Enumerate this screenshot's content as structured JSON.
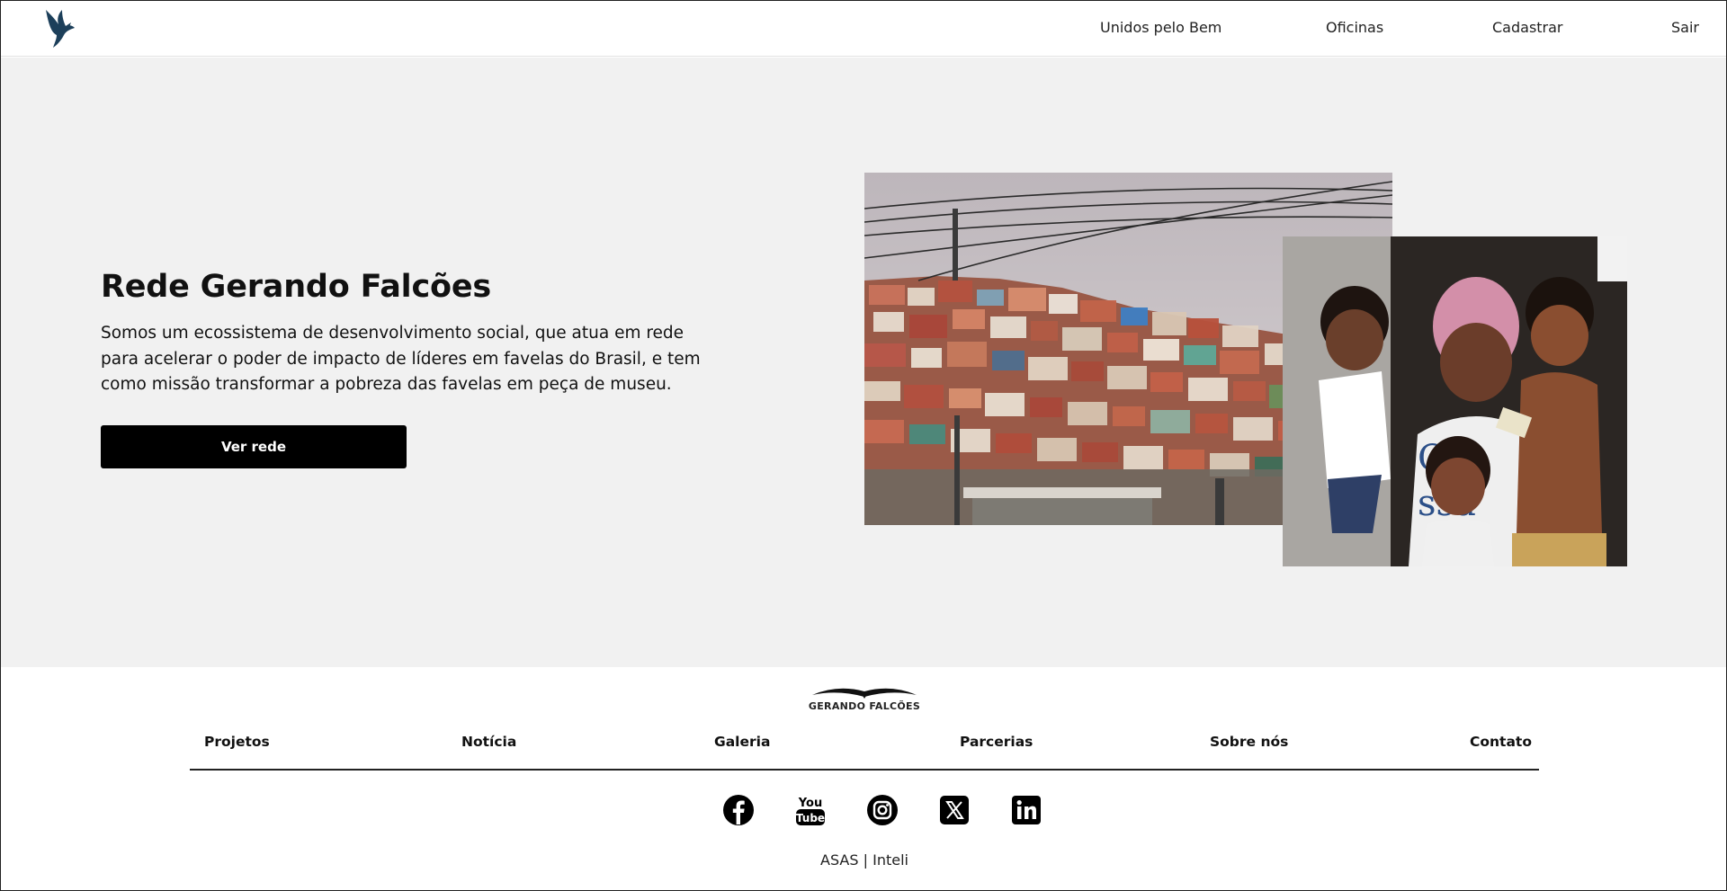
{
  "nav": {
    "logo_icon": "falcon-bird-icon",
    "links": [
      "Unidos pelo Bem",
      "Oficinas",
      "Cadastrar",
      "Sair"
    ]
  },
  "hero": {
    "title": "Rede Gerando Falcões",
    "description": "Somos um ecossistema de desenvolvimento social, que atua em rede para acelerar o poder de impacto de líderes em favelas do Brasil, e tem como missão transformar a pobreza das favelas em peça de museu.",
    "button_label": "Ver rede",
    "images": [
      "favela-hillside-photo",
      "family-children-photo"
    ]
  },
  "footer": {
    "brand": "GERANDO FALCÕES",
    "links": [
      "Projetos",
      "Notícia",
      "Galeria",
      "Parcerias",
      "Sobre nós",
      "Contato"
    ],
    "social_icons": [
      "facebook-icon",
      "youtube-icon",
      "instagram-icon",
      "x-twitter-icon",
      "linkedin-icon"
    ],
    "copyright": "ASAS | Inteli"
  },
  "colors": {
    "hero_bg": "#f1f1f1",
    "button_bg": "#000000",
    "logo_blue": "#1c3f5a"
  }
}
